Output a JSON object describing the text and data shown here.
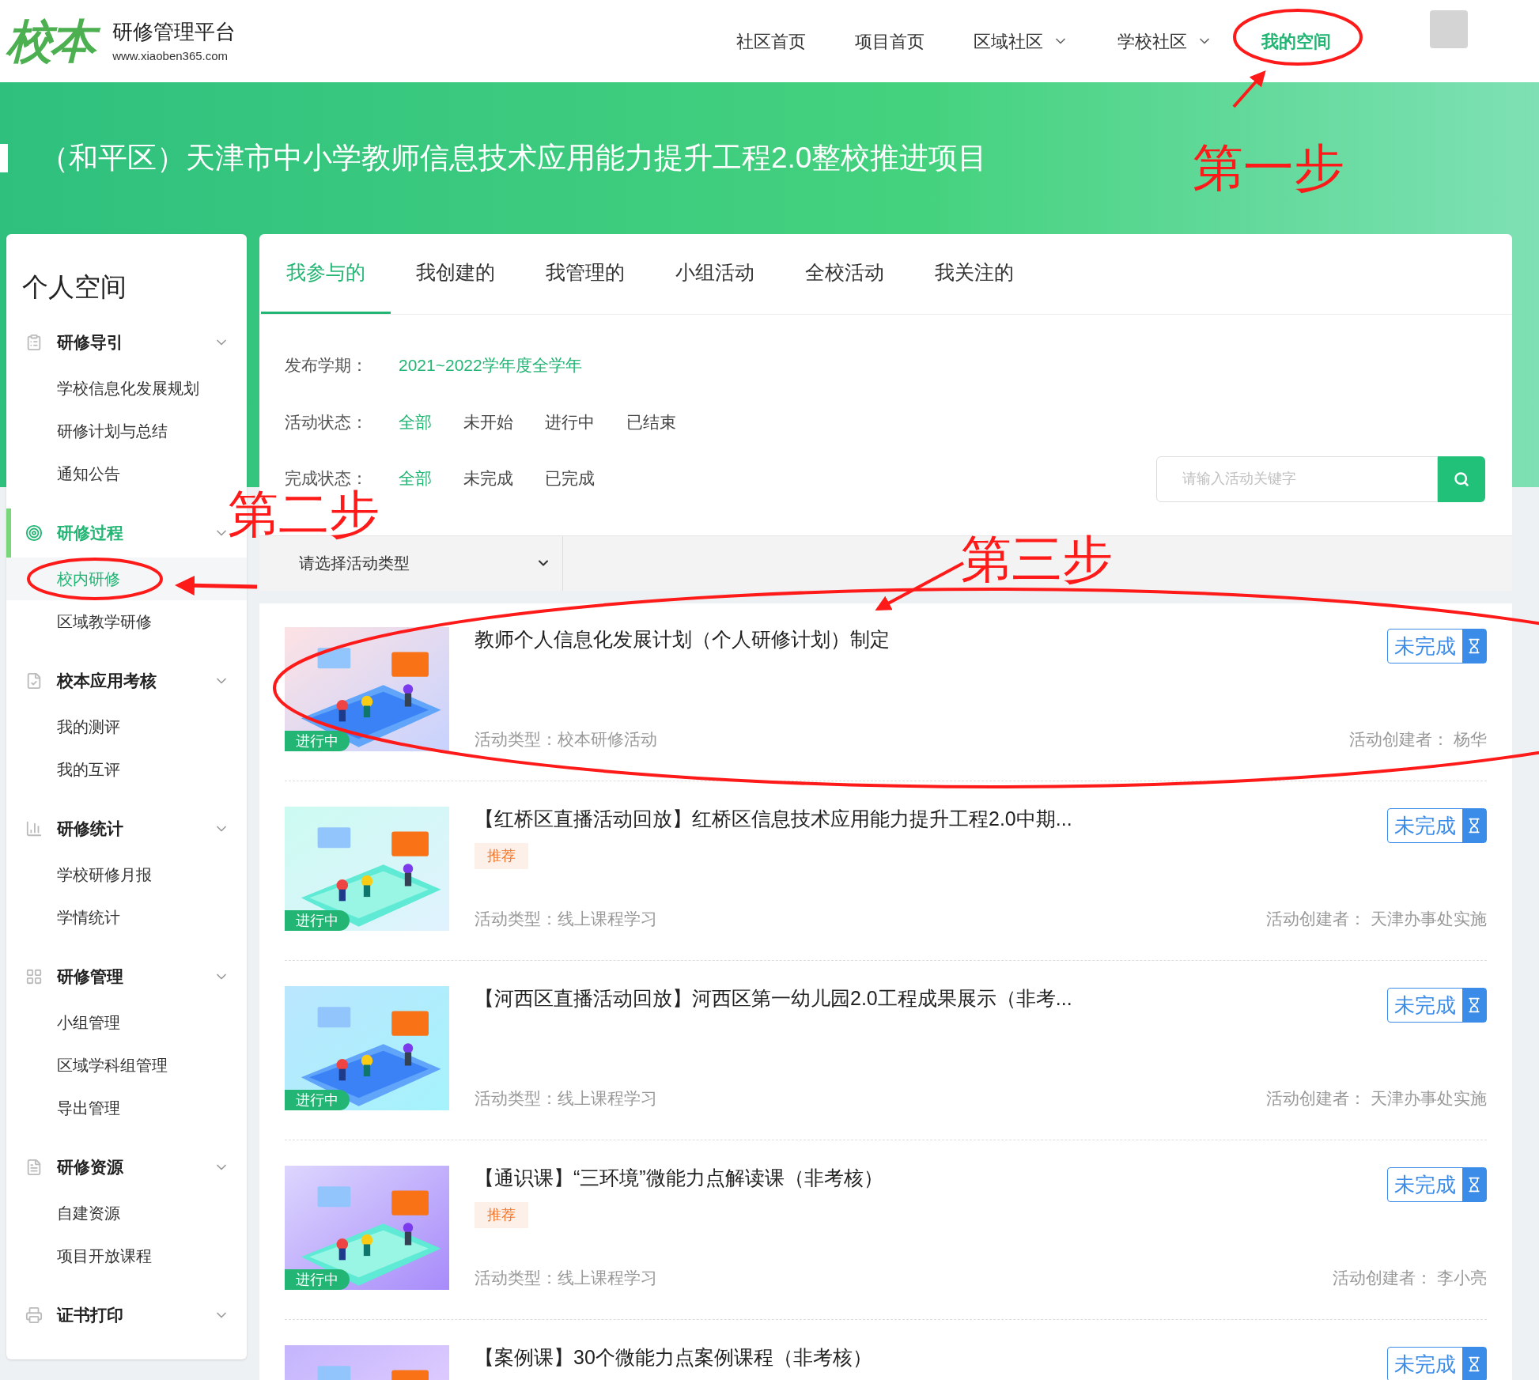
{
  "header": {
    "logo": {
      "mark": "校本",
      "name": "研修管理平台",
      "url": "www.xiaoben365.com"
    },
    "nav": [
      {
        "label": "社区首页",
        "dropdown": false,
        "selected": false
      },
      {
        "label": "项目首页",
        "dropdown": false,
        "selected": false
      },
      {
        "label": "区域社区",
        "dropdown": true,
        "selected": false
      },
      {
        "label": "学校社区",
        "dropdown": true,
        "selected": false
      },
      {
        "label": "我的空间",
        "dropdown": false,
        "selected": true
      }
    ]
  },
  "banner": {
    "title": "（和平区）天津市中小学教师信息技术应用能力提升工程2.0整校推进项目"
  },
  "sidebar": {
    "title": "个人空间",
    "groups": [
      {
        "label": "研修导引",
        "selected": false,
        "items": [
          {
            "label": "学校信息化发展规划",
            "selected": false
          },
          {
            "label": "研修计划与总结",
            "selected": false
          },
          {
            "label": "通知公告",
            "selected": false
          }
        ]
      },
      {
        "label": "研修过程",
        "selected": true,
        "items": [
          {
            "label": "校内研修",
            "selected": true
          },
          {
            "label": "区域教学研修",
            "selected": false
          }
        ]
      },
      {
        "label": "校本应用考核",
        "selected": false,
        "items": [
          {
            "label": "我的测评",
            "selected": false
          },
          {
            "label": "我的互评",
            "selected": false
          }
        ]
      },
      {
        "label": "研修统计",
        "selected": false,
        "items": [
          {
            "label": "学校研修月报",
            "selected": false
          },
          {
            "label": "学情统计",
            "selected": false
          }
        ]
      },
      {
        "label": "研修管理",
        "selected": false,
        "items": [
          {
            "label": "小组管理",
            "selected": false
          },
          {
            "label": "区域学科组管理",
            "selected": false
          },
          {
            "label": "导出管理",
            "selected": false
          }
        ]
      },
      {
        "label": "研修资源",
        "selected": false,
        "items": [
          {
            "label": "自建资源",
            "selected": false
          },
          {
            "label": "项目开放课程",
            "selected": false
          }
        ]
      },
      {
        "label": "证书打印",
        "selected": false
      }
    ]
  },
  "tabs": [
    {
      "label": "我参与的",
      "selected": true
    },
    {
      "label": "我创建的",
      "selected": false
    },
    {
      "label": "我管理的",
      "selected": false
    },
    {
      "label": "小组活动",
      "selected": false
    },
    {
      "label": "全校活动",
      "selected": false
    },
    {
      "label": "我关注的",
      "selected": false
    }
  ],
  "filters": [
    {
      "label": "发布学期：",
      "options": [
        {
          "label": "2021~2022学年度全学年",
          "selected": true
        }
      ]
    },
    {
      "label": "活动状态：",
      "options": [
        {
          "label": "全部",
          "selected": true
        },
        {
          "label": "未开始",
          "selected": false
        },
        {
          "label": "进行中",
          "selected": false
        },
        {
          "label": "已结束",
          "selected": false
        }
      ]
    },
    {
      "label": "完成状态：",
      "options": [
        {
          "label": "全部",
          "selected": true
        },
        {
          "label": "未完成",
          "selected": false
        },
        {
          "label": "已完成",
          "selected": false
        }
      ]
    }
  ],
  "search": {
    "placeholder": "请输入活动关键字"
  },
  "type_select": {
    "placeholder": "请选择活动类型"
  },
  "activities": [
    {
      "title": "教师个人信息化发展计划（个人研修计划）制定",
      "status": "进行中",
      "type_label": "活动类型：",
      "type": "校本研修活动",
      "creator_label": "活动创建者：",
      "creator": "杨华",
      "completion": "未完成"
    },
    {
      "title": "【红桥区直播活动回放】红桥区信息技术应用能力提升工程2.0中期...",
      "tag": "推荐",
      "status": "进行中",
      "type_label": "活动类型：",
      "type": "线上课程学习",
      "creator_label": "活动创建者：",
      "creator": "天津办事处实施",
      "completion": "未完成"
    },
    {
      "title": "【河西区直播活动回放】河西区第一幼儿园2.0工程成果展示（非考...",
      "status": "进行中",
      "type_label": "活动类型：",
      "type": "线上课程学习",
      "creator_label": "活动创建者：",
      "creator": "天津办事处实施",
      "completion": "未完成"
    },
    {
      "title": "【通识课】“三环境”微能力点解读课（非考核）",
      "tag": "推荐",
      "status": "进行中",
      "type_label": "活动类型：",
      "type": "线上课程学习",
      "creator_label": "活动创建者：",
      "creator": "李小亮",
      "completion": "未完成"
    },
    {
      "title": "【案例课】30个微能力点案例课程（非考核）",
      "completion": "未完成"
    }
  ],
  "annotations": [
    {
      "text": "第一步"
    },
    {
      "text": "第二步"
    },
    {
      "text": "第三步"
    }
  ]
}
